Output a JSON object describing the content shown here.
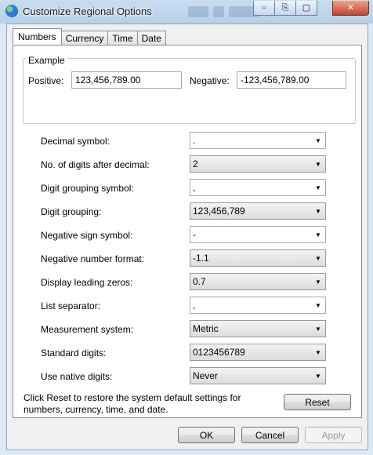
{
  "window": {
    "title": "Customize Regional Options",
    "icon": "globe-icon",
    "controls": [
      "minimize-icon",
      "restore-icon",
      "maximize-icon",
      "close-icon"
    ],
    "control_glyphs": [
      "▫",
      "⎘",
      "▢",
      "✕"
    ]
  },
  "tabs": [
    "Numbers",
    "Currency",
    "Time",
    "Date"
  ],
  "active_tab": "Numbers",
  "example": {
    "group_label": "Example",
    "positive_label": "Positive:",
    "positive_value": "123,456,789.00",
    "negative_label": "Negative:",
    "negative_value": "-123,456,789.00"
  },
  "settings": [
    {
      "label": "Decimal symbol:",
      "value": "."
    },
    {
      "label": "No. of digits after decimal:",
      "value": "2"
    },
    {
      "label": "Digit grouping symbol:",
      "value": ","
    },
    {
      "label": "Digit grouping:",
      "value": "123,456,789"
    },
    {
      "label": "Negative sign symbol:",
      "value": "-"
    },
    {
      "label": "Negative number format:",
      "value": "-1.1"
    },
    {
      "label": "Display leading zeros:",
      "value": "0.7"
    },
    {
      "label": "List separator:",
      "value": ","
    },
    {
      "label": "Measurement system:",
      "value": "Metric"
    },
    {
      "label": "Standard digits:",
      "value": "0123456789"
    },
    {
      "label": "Use native digits:",
      "value": "Never"
    }
  ],
  "reset_info": "Click Reset to restore the system default settings for numbers, currency, time, and date.",
  "buttons": {
    "reset": "Reset",
    "ok": "OK",
    "cancel": "Cancel",
    "apply": "Apply"
  },
  "dropdown_arrow": "▼"
}
